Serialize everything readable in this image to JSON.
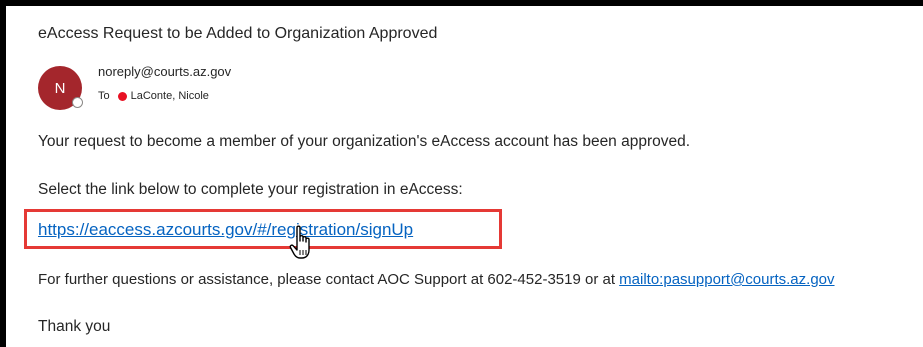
{
  "email": {
    "subject": "eAccess Request to be Added to Organization Approved",
    "avatar_initial": "N",
    "sender": "noreply@courts.az.gov",
    "to_label": "To",
    "recipient": "LaConte, Nicole",
    "body": {
      "line1": "Your request to become a member of your organization's eAccess account has been approved.",
      "line2": "Select the link below to complete your registration in eAccess:",
      "signup_link": "https://eaccess.azcourts.gov/#/registration/signUp",
      "support_text": "For further questions or assistance, please contact AOC Support at 602-452-3519 or at ",
      "support_link": "mailto:pasupport@courts.az.gov",
      "closing": "Thank you"
    }
  },
  "colors": {
    "avatar": "#a4262c",
    "link": "#0563c1",
    "highlight": "#e53935",
    "recipient_status": "#e81123"
  },
  "icons": {
    "cursor": "hand-pointer-icon"
  }
}
